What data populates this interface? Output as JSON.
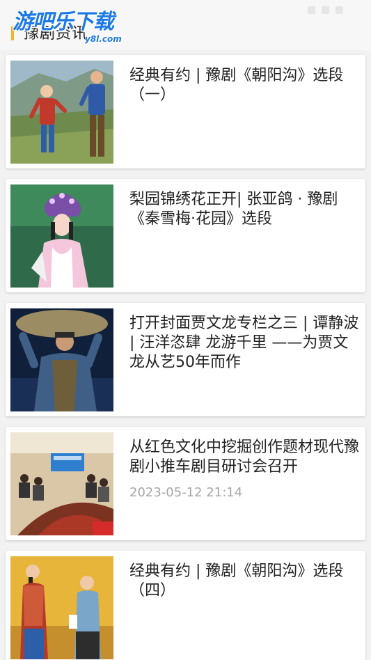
{
  "header": {
    "title": "豫剧资讯",
    "accent_color": "#f2b230"
  },
  "watermark": {
    "main": "游吧乐下载",
    "sub": "y8l.com"
  },
  "articles": [
    {
      "title": "经典有约 | 豫剧《朝阳沟》选段（一）",
      "date": "",
      "thumbnail": "opera-duet-mountain-scene"
    },
    {
      "title": "梨园锦绣花正开| 张亚鸽 · 豫剧《秦雪梅·花园》选段",
      "date": "",
      "thumbnail": "opera-actress-headdress"
    },
    {
      "title": "打开封面贾文龙专栏之三 | 谭静波 | 汪洋恣肆 龙游千里 ——为贾文龙从艺50年而作",
      "date": "",
      "thumbnail": "opera-actor-carrying-sack"
    },
    {
      "title": "从红色文化中挖掘创作题材现代豫剧小推车剧目研讨会召开",
      "date": "2023-05-12 21:14",
      "thumbnail": "conference-meeting-room"
    },
    {
      "title": "经典有约 | 豫剧《朝阳沟》选段（四）",
      "date": "",
      "thumbnail": "opera-two-actresses-stage"
    }
  ]
}
